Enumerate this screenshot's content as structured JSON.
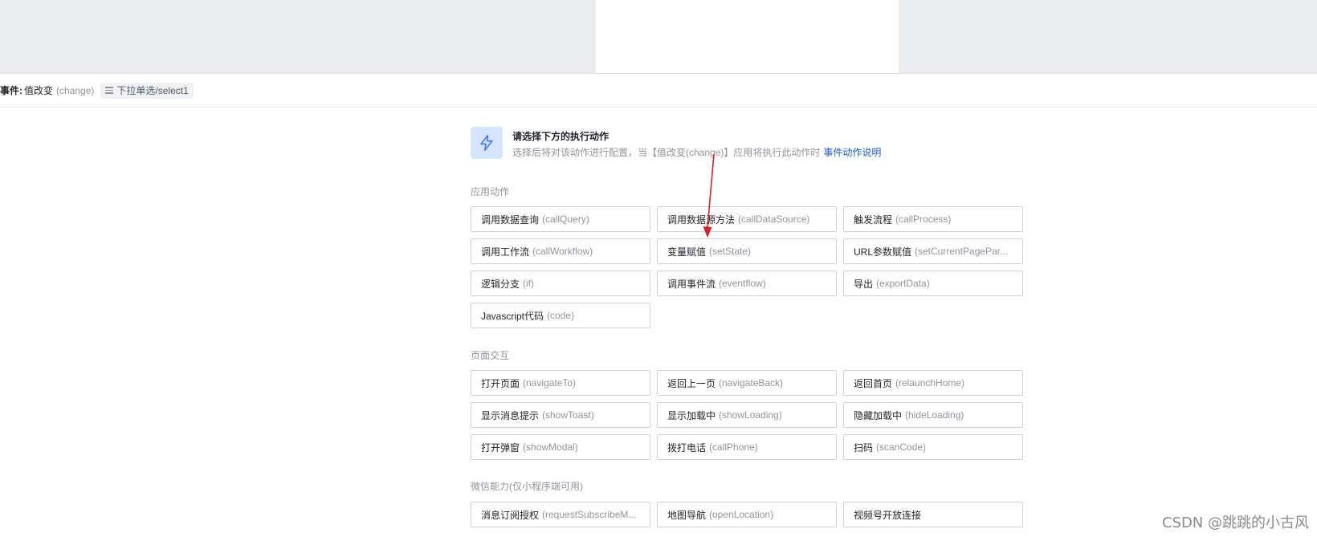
{
  "event_header": {
    "prefix": "事件:",
    "event_name": "值改变",
    "event_code": "(change)",
    "component_tag": "下拉单选/select1"
  },
  "intro": {
    "icon": "lightning-icon",
    "title": "请选择下方的执行动作",
    "description": "选择后将对该动作进行配置，当【值改变(change)】应用将执行此动作时",
    "link_text": "事件动作说明"
  },
  "sections": [
    {
      "title": "应用动作",
      "actions": [
        {
          "name": "调用数据查询",
          "code": "(callQuery)"
        },
        {
          "name": "调用数据源方法",
          "code": "(callDataSource)"
        },
        {
          "name": "触发流程",
          "code": "(callProcess)"
        },
        {
          "name": "调用工作流",
          "code": "(callWorkflow)"
        },
        {
          "name": "变量赋值",
          "code": "(setState)"
        },
        {
          "name": "URL参数赋值",
          "code": "(setCurrentPagePar..."
        },
        {
          "name": "逻辑分支",
          "code": "(if)"
        },
        {
          "name": "调用事件流",
          "code": "(eventflow)"
        },
        {
          "name": "导出",
          "code": "(exportData)"
        },
        {
          "name": "Javascript代码",
          "code": "(code)"
        }
      ]
    },
    {
      "title": "页面交互",
      "actions": [
        {
          "name": "打开页面",
          "code": "(navigateTo)"
        },
        {
          "name": "返回上一页",
          "code": "(navigateBack)"
        },
        {
          "name": "返回首页",
          "code": "(relaunchHome)"
        },
        {
          "name": "显示消息提示",
          "code": "(showToast)"
        },
        {
          "name": "显示加载中",
          "code": "(showLoading)"
        },
        {
          "name": "隐藏加载中",
          "code": "(hideLoading)"
        },
        {
          "name": "打开弹窗",
          "code": "(showModal)"
        },
        {
          "name": "拨打电话",
          "code": "(callPhone)"
        },
        {
          "name": "扫码",
          "code": "(scanCode)"
        }
      ]
    },
    {
      "title": "微信能力(仅小程序端可用)",
      "actions": [
        {
          "name": "消息订阅授权",
          "code": "(requestSubscribeM..."
        },
        {
          "name": "地图导航",
          "code": "(openLocation)"
        },
        {
          "name": "视频号开放连接",
          "code": ""
        }
      ]
    }
  ],
  "annotation": {
    "arrow_color": "#e02020"
  },
  "watermark": "CSDN @跳跳的小古风",
  "colors": {
    "accent": "#1f5ad6",
    "icon_bg": "#d6e4ff",
    "muted": "#8f959e",
    "border": "#d0d3d6"
  }
}
